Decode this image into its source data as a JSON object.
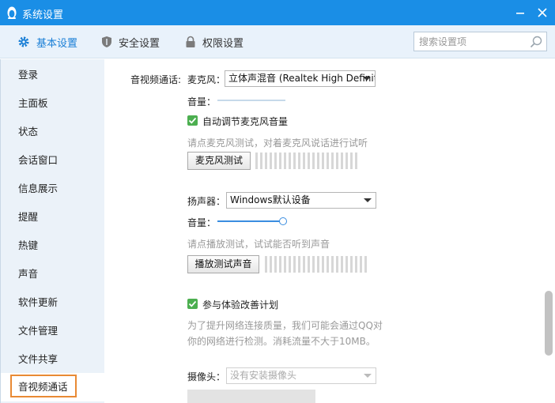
{
  "window": {
    "title": "系统设置"
  },
  "tabs": [
    {
      "label": "基本设置",
      "icon": "gear-icon",
      "active": true
    },
    {
      "label": "安全设置",
      "icon": "shield-icon",
      "active": false
    },
    {
      "label": "权限设置",
      "icon": "lock-icon",
      "active": false
    }
  ],
  "search": {
    "placeholder": "搜索设置项",
    "value": ""
  },
  "sidebar": {
    "items": [
      {
        "label": "登录"
      },
      {
        "label": "主面板"
      },
      {
        "label": "状态"
      },
      {
        "label": "会话窗口"
      },
      {
        "label": "信息展示"
      },
      {
        "label": "提醒"
      },
      {
        "label": "热键"
      },
      {
        "label": "声音"
      },
      {
        "label": "软件更新"
      },
      {
        "label": "文件管理"
      },
      {
        "label": "文件共享"
      },
      {
        "label": "音视频通话",
        "selected": true
      }
    ]
  },
  "av": {
    "section_label": "音视频通话:",
    "mic": {
      "label": "麦克风：",
      "device": "立体声混音 (Realtek High Definition Audio)",
      "volume_label": "音量：",
      "auto_adjust_label": "自动调节麦克风音量",
      "auto_adjust_checked": true,
      "hint": "请点麦克风测试，对着麦克风说话进行试听",
      "test_button": "麦克风测试"
    },
    "speaker": {
      "label": "扬声器：",
      "device": "Windows默认设备",
      "volume_label": "音量：",
      "volume_level": 0.95,
      "hint": "请点播放测试，试试能否听到声音",
      "test_button": "播放测试声音"
    },
    "improve": {
      "label": "参与体验改善计划",
      "checked": true,
      "desc_line1": "为了提升网络连接质量，我们可能会通过QQ对",
      "desc_line2": "你的网络进行检测。消耗流量不大于10MB。"
    },
    "camera": {
      "label": "摄像头：",
      "device": "没有安装摄像头"
    }
  },
  "colors": {
    "titlebar": "#1a8ee6",
    "accent": "#1a7fd6",
    "selected_outline": "#e98a34",
    "check_green": "#4caf50"
  }
}
